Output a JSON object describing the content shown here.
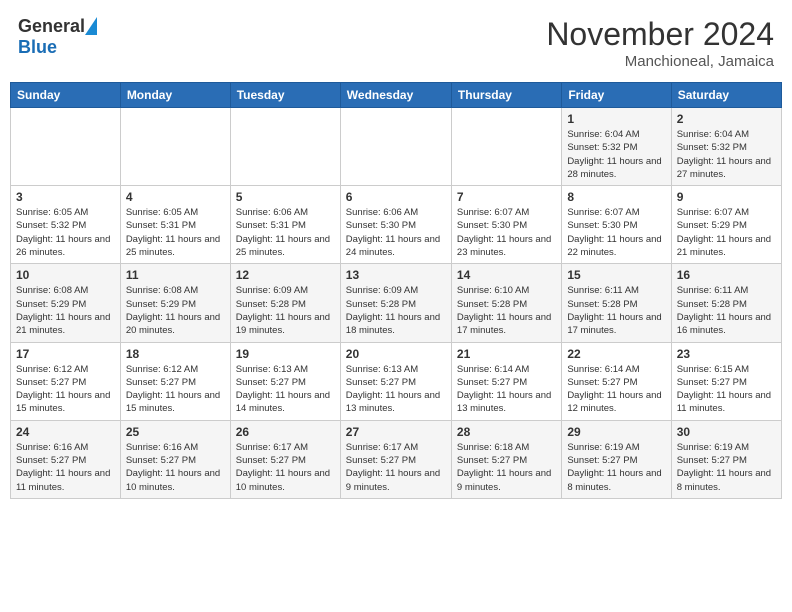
{
  "header": {
    "logo_line1": "General",
    "logo_line2": "Blue",
    "month_title": "November 2024",
    "location": "Manchioneal, Jamaica"
  },
  "calendar": {
    "weekdays": [
      "Sunday",
      "Monday",
      "Tuesday",
      "Wednesday",
      "Thursday",
      "Friday",
      "Saturday"
    ],
    "weeks": [
      [
        {
          "day": "",
          "info": ""
        },
        {
          "day": "",
          "info": ""
        },
        {
          "day": "",
          "info": ""
        },
        {
          "day": "",
          "info": ""
        },
        {
          "day": "",
          "info": ""
        },
        {
          "day": "1",
          "info": "Sunrise: 6:04 AM\nSunset: 5:32 PM\nDaylight: 11 hours and 28 minutes."
        },
        {
          "day": "2",
          "info": "Sunrise: 6:04 AM\nSunset: 5:32 PM\nDaylight: 11 hours and 27 minutes."
        }
      ],
      [
        {
          "day": "3",
          "info": "Sunrise: 6:05 AM\nSunset: 5:32 PM\nDaylight: 11 hours and 26 minutes."
        },
        {
          "day": "4",
          "info": "Sunrise: 6:05 AM\nSunset: 5:31 PM\nDaylight: 11 hours and 25 minutes."
        },
        {
          "day": "5",
          "info": "Sunrise: 6:06 AM\nSunset: 5:31 PM\nDaylight: 11 hours and 25 minutes."
        },
        {
          "day": "6",
          "info": "Sunrise: 6:06 AM\nSunset: 5:30 PM\nDaylight: 11 hours and 24 minutes."
        },
        {
          "day": "7",
          "info": "Sunrise: 6:07 AM\nSunset: 5:30 PM\nDaylight: 11 hours and 23 minutes."
        },
        {
          "day": "8",
          "info": "Sunrise: 6:07 AM\nSunset: 5:30 PM\nDaylight: 11 hours and 22 minutes."
        },
        {
          "day": "9",
          "info": "Sunrise: 6:07 AM\nSunset: 5:29 PM\nDaylight: 11 hours and 21 minutes."
        }
      ],
      [
        {
          "day": "10",
          "info": "Sunrise: 6:08 AM\nSunset: 5:29 PM\nDaylight: 11 hours and 21 minutes."
        },
        {
          "day": "11",
          "info": "Sunrise: 6:08 AM\nSunset: 5:29 PM\nDaylight: 11 hours and 20 minutes."
        },
        {
          "day": "12",
          "info": "Sunrise: 6:09 AM\nSunset: 5:28 PM\nDaylight: 11 hours and 19 minutes."
        },
        {
          "day": "13",
          "info": "Sunrise: 6:09 AM\nSunset: 5:28 PM\nDaylight: 11 hours and 18 minutes."
        },
        {
          "day": "14",
          "info": "Sunrise: 6:10 AM\nSunset: 5:28 PM\nDaylight: 11 hours and 17 minutes."
        },
        {
          "day": "15",
          "info": "Sunrise: 6:11 AM\nSunset: 5:28 PM\nDaylight: 11 hours and 17 minutes."
        },
        {
          "day": "16",
          "info": "Sunrise: 6:11 AM\nSunset: 5:28 PM\nDaylight: 11 hours and 16 minutes."
        }
      ],
      [
        {
          "day": "17",
          "info": "Sunrise: 6:12 AM\nSunset: 5:27 PM\nDaylight: 11 hours and 15 minutes."
        },
        {
          "day": "18",
          "info": "Sunrise: 6:12 AM\nSunset: 5:27 PM\nDaylight: 11 hours and 15 minutes."
        },
        {
          "day": "19",
          "info": "Sunrise: 6:13 AM\nSunset: 5:27 PM\nDaylight: 11 hours and 14 minutes."
        },
        {
          "day": "20",
          "info": "Sunrise: 6:13 AM\nSunset: 5:27 PM\nDaylight: 11 hours and 13 minutes."
        },
        {
          "day": "21",
          "info": "Sunrise: 6:14 AM\nSunset: 5:27 PM\nDaylight: 11 hours and 13 minutes."
        },
        {
          "day": "22",
          "info": "Sunrise: 6:14 AM\nSunset: 5:27 PM\nDaylight: 11 hours and 12 minutes."
        },
        {
          "day": "23",
          "info": "Sunrise: 6:15 AM\nSunset: 5:27 PM\nDaylight: 11 hours and 11 minutes."
        }
      ],
      [
        {
          "day": "24",
          "info": "Sunrise: 6:16 AM\nSunset: 5:27 PM\nDaylight: 11 hours and 11 minutes."
        },
        {
          "day": "25",
          "info": "Sunrise: 6:16 AM\nSunset: 5:27 PM\nDaylight: 11 hours and 10 minutes."
        },
        {
          "day": "26",
          "info": "Sunrise: 6:17 AM\nSunset: 5:27 PM\nDaylight: 11 hours and 10 minutes."
        },
        {
          "day": "27",
          "info": "Sunrise: 6:17 AM\nSunset: 5:27 PM\nDaylight: 11 hours and 9 minutes."
        },
        {
          "day": "28",
          "info": "Sunrise: 6:18 AM\nSunset: 5:27 PM\nDaylight: 11 hours and 9 minutes."
        },
        {
          "day": "29",
          "info": "Sunrise: 6:19 AM\nSunset: 5:27 PM\nDaylight: 11 hours and 8 minutes."
        },
        {
          "day": "30",
          "info": "Sunrise: 6:19 AM\nSunset: 5:27 PM\nDaylight: 11 hours and 8 minutes."
        }
      ]
    ]
  }
}
